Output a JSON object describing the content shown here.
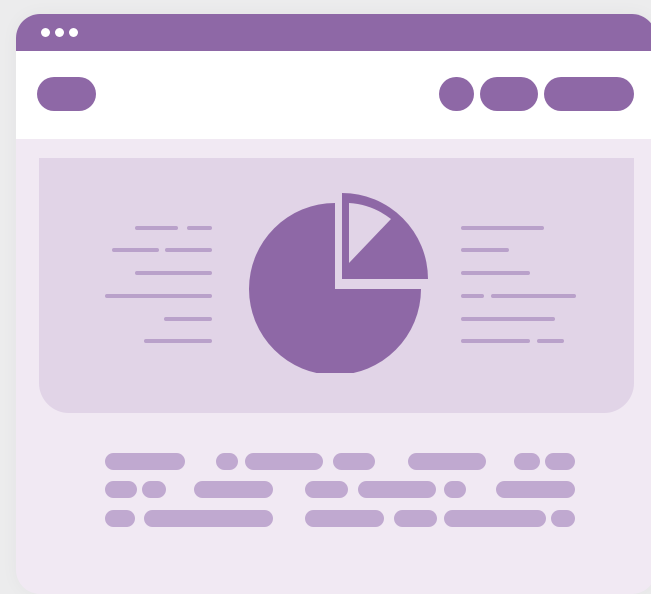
{
  "window": {
    "title_dots": [
      "dot-1",
      "dot-2",
      "dot-3"
    ]
  },
  "colors": {
    "accent": "#8e68a6",
    "hero_bg": "#e1d4e7",
    "page_bg": "#f1e9f3",
    "text_placeholder": "#b9a1ca",
    "footer_placeholder": "#c0a9d0"
  },
  "icons": {
    "chart": "pie-chart-icon"
  },
  "pie_chart": {
    "type": "pie",
    "slices": [
      {
        "name": "",
        "value": 87.5
      },
      {
        "name": "",
        "value": 12.5
      }
    ]
  }
}
